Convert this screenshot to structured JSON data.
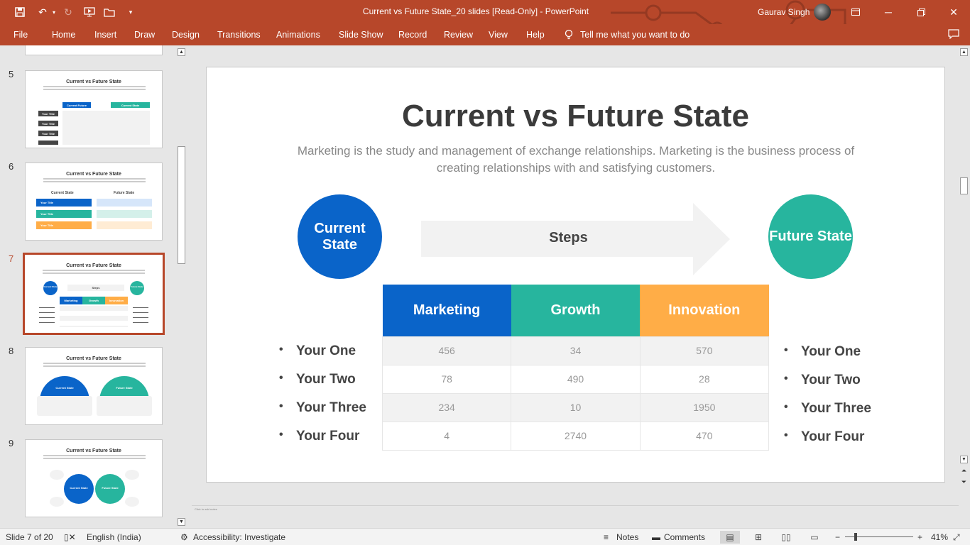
{
  "titlebar": {
    "title": "Current vs Future State_20 slides [Read-Only]  -  PowerPoint",
    "user": "Gaurav Singh"
  },
  "ribbon": {
    "tabs": [
      "File",
      "Home",
      "Insert",
      "Draw",
      "Design",
      "Transitions",
      "Animations",
      "Slide Show",
      "Record",
      "Review",
      "View",
      "Help"
    ],
    "tell_me": "Tell me what you want to do"
  },
  "thumbnails": {
    "numbers": [
      "5",
      "6",
      "7",
      "8",
      "9"
    ],
    "title": "Current vs Future State",
    "t5": {
      "current": "Current Future",
      "future": "Current State",
      "row_label": "Your Title"
    },
    "t6": {
      "current": "Current State",
      "future": "Future State",
      "row_label": "Your Title"
    },
    "t7": {
      "current": "Current State",
      "future": "Future State",
      "steps": "Steps",
      "cols": [
        "Marketing",
        "Growth",
        "Innovation"
      ]
    },
    "t8": {
      "current": "Current State",
      "future": "Future State"
    },
    "t9": {
      "current": "Current State",
      "future": "Future State"
    }
  },
  "slide": {
    "title": "Current vs Future State",
    "subtitle": "Marketing is the study and management of exchange relationships. Marketing is the business process of creating relationships with and satisfying customers.",
    "current_circle": "Current State",
    "future_circle": "Future State",
    "steps": "Steps",
    "columns": [
      "Marketing",
      "Growth",
      "Innovation"
    ],
    "rows": [
      [
        "456",
        "34",
        "570"
      ],
      [
        "78",
        "490",
        "28"
      ],
      [
        "234",
        "10",
        "1950"
      ],
      [
        "4",
        "2740",
        "470"
      ]
    ],
    "left_bullets": [
      "Your One",
      "Your Two",
      "Your Three",
      "Your Four"
    ],
    "right_bullets": [
      "Your One",
      "Your Two",
      "Your Three",
      "Your Four"
    ]
  },
  "notes_placeholder": "Click to add notes",
  "statusbar": {
    "slide_info": "Slide 7 of 20",
    "language": "English (India)",
    "accessibility": "Accessibility: Investigate",
    "notes": "Notes",
    "comments": "Comments",
    "zoom": "41%",
    "minus": "−",
    "plus": "+"
  },
  "colors": {
    "brand": "#b7472a",
    "blue": "#0a64c9",
    "teal": "#27b59e",
    "orange": "#ffad47"
  },
  "icons": {
    "save": "save-icon",
    "undo": "undo-icon",
    "redo": "redo-icon",
    "present": "present-icon",
    "open": "folder-icon",
    "customize": "chevron-down-icon",
    "tell_me": "lightbulb-icon",
    "share": "comment-icon"
  }
}
